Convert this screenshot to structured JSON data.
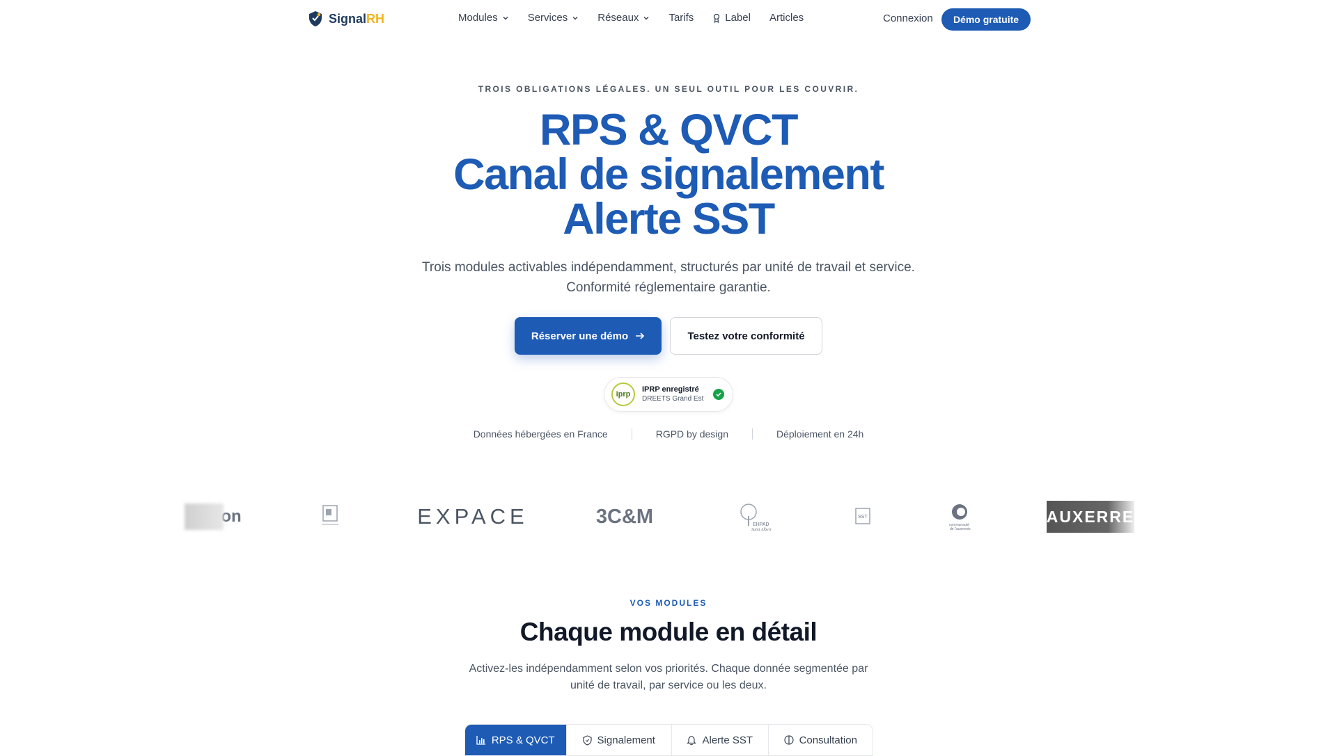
{
  "nav": {
    "logo_main": "Signal",
    "logo_accent": "RH",
    "items": [
      {
        "label": "Modules",
        "dropdown": true
      },
      {
        "label": "Services",
        "dropdown": true
      },
      {
        "label": "Réseaux",
        "dropdown": true
      },
      {
        "label": "Tarifs",
        "dropdown": false
      },
      {
        "label": "Label",
        "dropdown": false,
        "icon": "ribbon-icon"
      },
      {
        "label": "Articles",
        "dropdown": false
      }
    ],
    "login_label": "Connexion",
    "demo_label": "Démo gratuite"
  },
  "hero": {
    "kicker": "TROIS OBLIGATIONS LÉGALES. UN SEUL OUTIL POUR LES COUVRIR.",
    "title_lines": [
      "RPS & QVCT",
      "Canal de signalement",
      "Alerte SST"
    ],
    "lead": "Trois modules activables indépendamment, structurés par unité de travail et service. Conformité réglementaire garantie.",
    "primary_cta": "Réserver une démo",
    "secondary_cta": "Testez votre conformité",
    "badge": {
      "logo_text": "iprp",
      "title": "IPRP enregistré",
      "subtitle": "DREETS Grand Est"
    },
    "features": [
      "Données hébergées en France",
      "RGPD by design",
      "Déploiement en 24h"
    ]
  },
  "logos": [
    {
      "text": "on",
      "name": "region-logo"
    },
    {
      "text": "",
      "name": "davidson-logo"
    },
    {
      "text": "EXPACE",
      "name": "expace-logo"
    },
    {
      "text": "3C&M",
      "name": "3cm-logo"
    },
    {
      "text": "EHPAD Saint Albert",
      "name": "ehpad-logo"
    },
    {
      "text": "SST",
      "name": "sst-logo"
    },
    {
      "text": "communauté de l'auxerrois",
      "name": "auxerrois-logo"
    },
    {
      "text": "AUXERRE",
      "name": "auxerre-logo"
    }
  ],
  "modules": {
    "eyebrow": "VOS MODULES",
    "title": "Chaque module en détail",
    "lead": "Activez-les indépendamment selon vos priorités. Chaque donnée segmentée par unité de travail, par service ou les deux.",
    "tabs": [
      {
        "label": "RPS & QVCT",
        "icon": "bar-chart-icon",
        "active": true
      },
      {
        "label": "Signalement",
        "icon": "shield-icon",
        "active": false
      },
      {
        "label": "Alerte SST",
        "icon": "bell-icon",
        "active": false
      },
      {
        "label": "Consultation",
        "icon": "split-circle-icon",
        "active": false
      }
    ]
  },
  "colors": {
    "brand": "#1d5bb5",
    "logo_accent": "#f2b51f",
    "check": "#16a34a"
  }
}
